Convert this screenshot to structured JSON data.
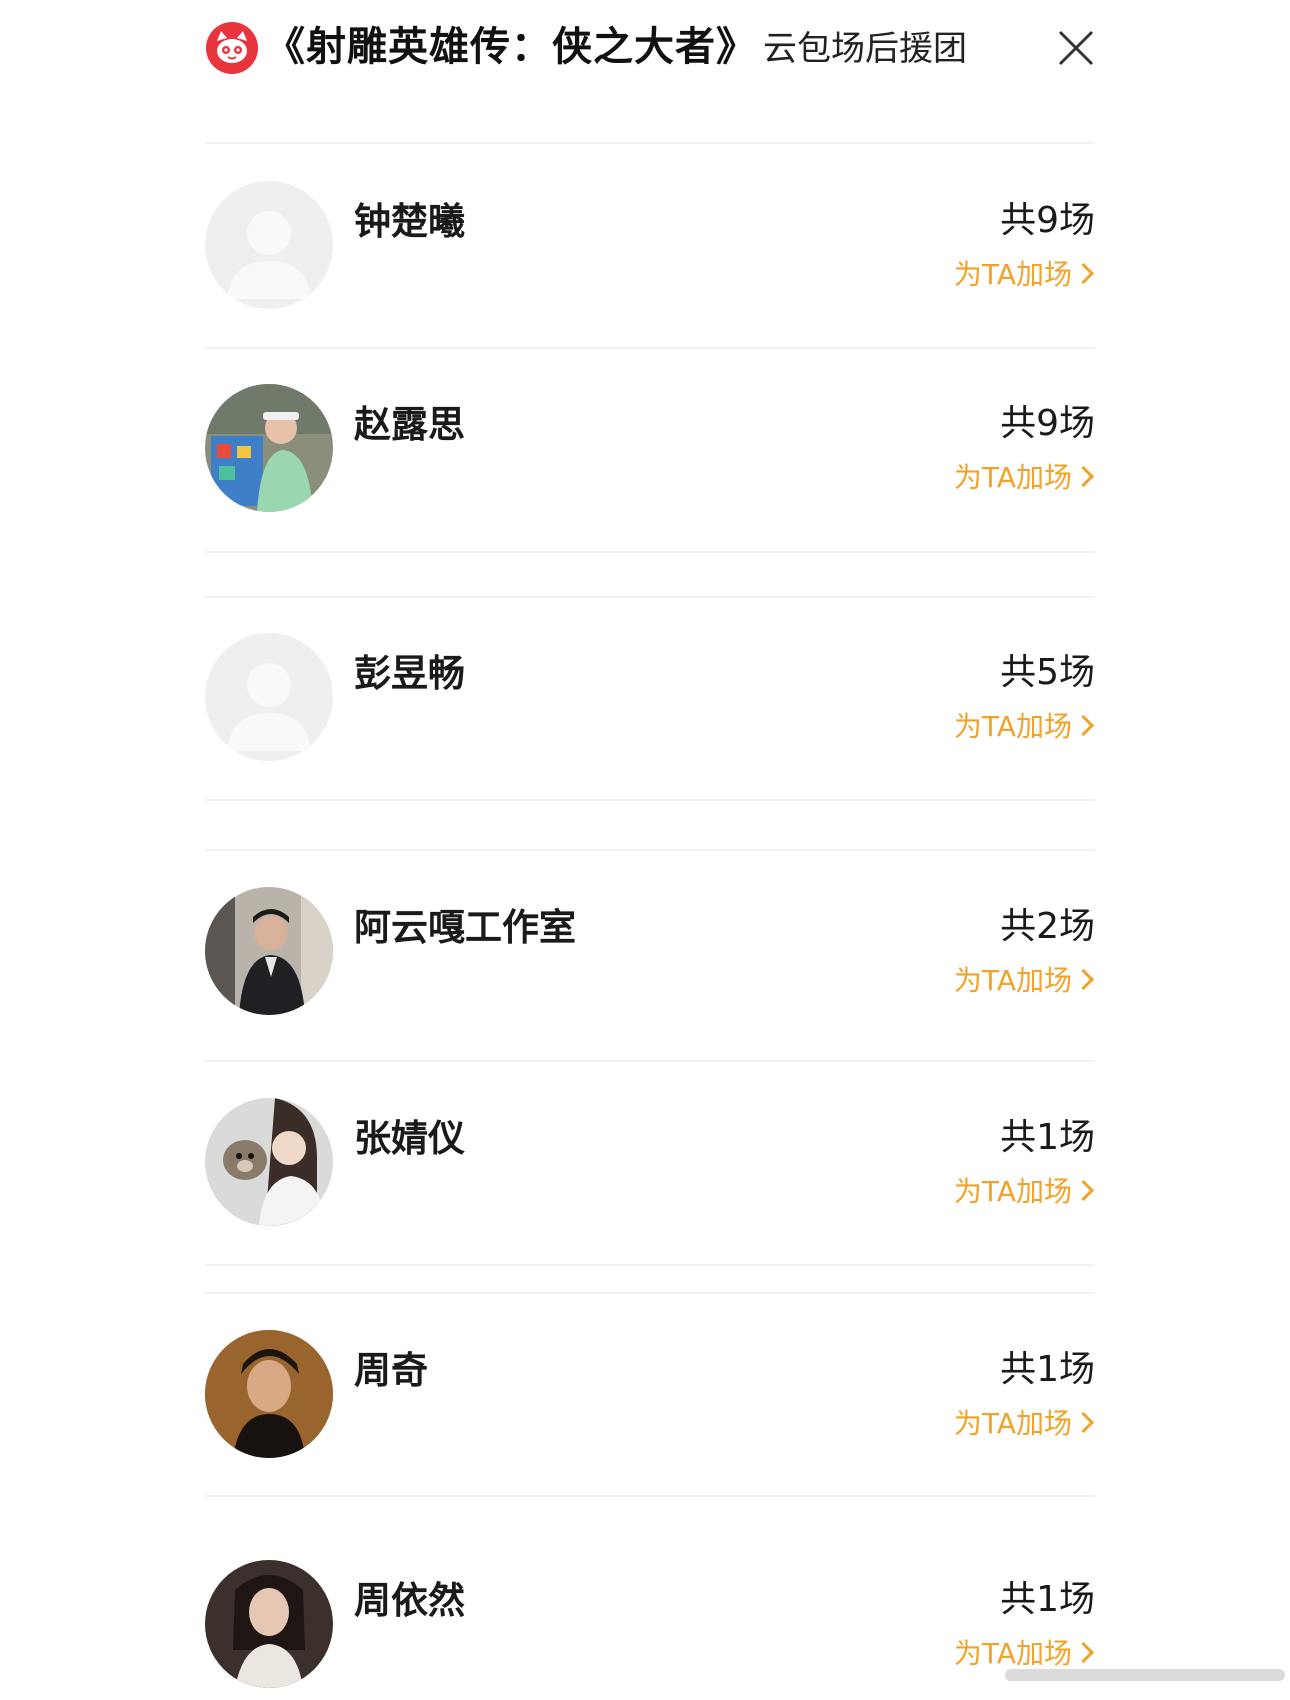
{
  "header": {
    "title": "《射雕英雄传：侠之大者》",
    "subtitle": "云包场后援团",
    "logo_icon": "cat-logo-icon",
    "close_icon": "close-icon"
  },
  "colors": {
    "accent": "#f2a228",
    "brand": "#e8343c",
    "divider": "#f1f1f1"
  },
  "list": [
    {
      "name": "钟楚曦",
      "count": "共9场",
      "action": "为TA加场",
      "avatar": "placeholder"
    },
    {
      "name": "赵露思",
      "count": "共9场",
      "action": "为TA加场",
      "avatar": "photo"
    },
    {
      "name": "彭昱畅",
      "count": "共5场",
      "action": "为TA加场",
      "avatar": "placeholder"
    },
    {
      "name": "阿云嘎工作室",
      "count": "共2场",
      "action": "为TA加场",
      "avatar": "photo"
    },
    {
      "name": "张婧仪",
      "count": "共1场",
      "action": "为TA加场",
      "avatar": "photo"
    },
    {
      "name": "周奇",
      "count": "共1场",
      "action": "为TA加场",
      "avatar": "photo"
    },
    {
      "name": "周依然",
      "count": "共1场",
      "action": "为TA加场",
      "avatar": "photo"
    }
  ]
}
